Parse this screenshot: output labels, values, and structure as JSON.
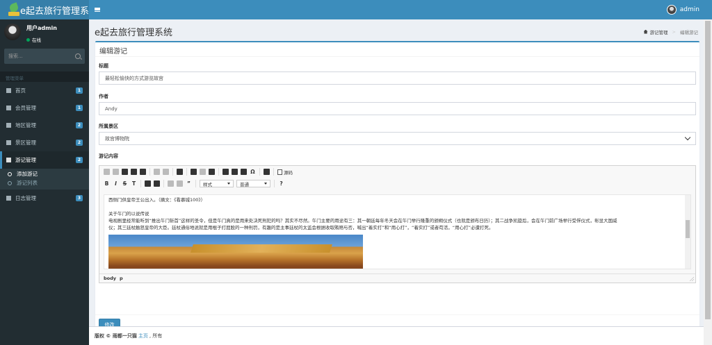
{
  "header": {
    "logo_text": "e起去旅行管理系",
    "user_name": "admin"
  },
  "sidebar": {
    "user": {
      "name": "用户admin",
      "status": "在线"
    },
    "search_placeholder": "搜索...",
    "menu_header": "管理菜单",
    "items": [
      {
        "label": "首页",
        "badge": "1",
        "icon": "home-icon"
      },
      {
        "label": "会员管理",
        "badge": "1",
        "icon": "users-icon"
      },
      {
        "label": "地区管理",
        "badge": "2",
        "icon": "location-icon"
      },
      {
        "label": "景区管理",
        "badge": "2",
        "icon": "scenic-icon"
      },
      {
        "label": "游记管理",
        "badge": "2",
        "icon": "book-icon"
      },
      {
        "label": "日志管理",
        "badge": "3",
        "icon": "log-icon"
      }
    ],
    "sub_items": [
      {
        "label": "添加游记"
      },
      {
        "label": "游记列表"
      }
    ]
  },
  "content": {
    "page_title": "e起去旅行管理系统",
    "breadcrumb": {
      "parent": "游记管理",
      "current": "编辑游记"
    },
    "box_title": "编辑游记",
    "form": {
      "title_label": "标题",
      "title_value": "最轻松愉快的方式游览故宫",
      "author_label": "作者",
      "author_value": "Andy",
      "scenic_label": "所属景区",
      "scenic_value": "故宫博物院",
      "body_label": "游记内容"
    },
    "editor": {
      "style_combo": "样式",
      "format_combo": "普通",
      "source_label": "源码",
      "lines": [
        "西侧门供皇帝王公出入。（摘文：《看慕城100》）",
        "",
        "关于午门的以说传说",
        "电视剧里经常能听到“推出午门斩首”这样的圣令，但是午门真的是用来处决死刑犯的吗？其实不尽然。午门主要的用途有三：其一朝廷每年冬天会在午门举行隆重的颁朔仪式（也就是颁布日历）；其二战争凯旋后，会在午门前广场举行受俘仪式，彰显大国威",
        "仪；其三廷杖触怒皇帝的大臣。廷杖通俗地说就是用棍子打屁股的一种刑罚，有趣的是主事廷杖的太监会根据收取贿赂与否，喊出“着实打”和“用心打”，“着实打”或者苟活，“用心打”必遭打死。"
      ],
      "status_path": [
        "body",
        "p"
      ]
    },
    "submit_label": "修改"
  },
  "footer": {
    "copyright": "版权 © 雨都一只猫",
    "link": "主页",
    "suffix": ", 所有"
  },
  "colors": {
    "primary": "#3c8dbc",
    "sidebar_bg": "#222d32",
    "header_logo_bg": "#367fa9"
  }
}
